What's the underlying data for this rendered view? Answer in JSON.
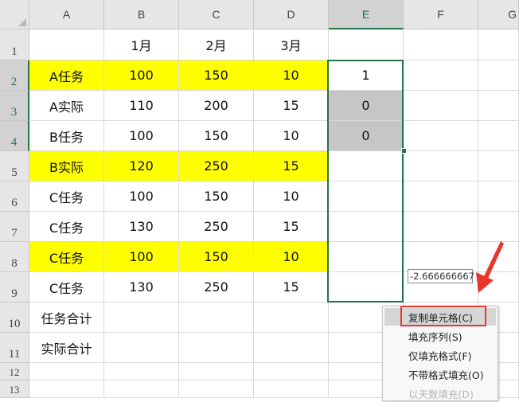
{
  "columns": [
    "A",
    "B",
    "C",
    "D",
    "E",
    "F",
    "G"
  ],
  "rows": [
    "1",
    "2",
    "3",
    "4",
    "5",
    "6",
    "7",
    "8",
    "9",
    "10",
    "11",
    "12",
    "13"
  ],
  "header_row": {
    "B": "1月",
    "C": "2月",
    "D": "3月"
  },
  "table": [
    {
      "label": "A任务",
      "b": "100",
      "c": "150",
      "d": "10",
      "e": "1"
    },
    {
      "label": "A实际",
      "b": "110",
      "c": "200",
      "d": "15",
      "e": "0"
    },
    {
      "label": "B任务",
      "b": "100",
      "c": "150",
      "d": "10",
      "e": "0"
    },
    {
      "label": "B实际",
      "b": "120",
      "c": "250",
      "d": "15",
      "e": ""
    },
    {
      "label": "C任务",
      "b": "100",
      "c": "150",
      "d": "10",
      "e": ""
    },
    {
      "label": "C任务",
      "b": "130",
      "c": "250",
      "d": "15",
      "e": ""
    },
    {
      "label": "C任务",
      "b": "100",
      "c": "150",
      "d": "10",
      "e": ""
    },
    {
      "label": "C任务",
      "b": "130",
      "c": "250",
      "d": "15",
      "e": ""
    }
  ],
  "summary": {
    "task_total": "任务合计",
    "actual_total": "实际合计"
  },
  "tooltip": "-2.666666667",
  "context_menu": {
    "items": [
      "复制单元格(C)",
      "填充序列(S)",
      "仅填充格式(F)",
      "不带格式填充(O)",
      "以天数填充(D)"
    ]
  },
  "colors": {
    "highlight_yellow": "#ffff00",
    "selection_green": "#217346",
    "annotation_red": "#e8362d",
    "selected_gray": "#c6c6c6"
  }
}
